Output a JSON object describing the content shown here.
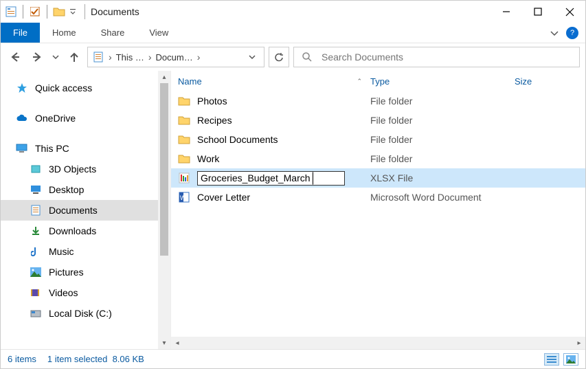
{
  "titlebar": {
    "title": "Documents"
  },
  "ribbon": {
    "file": "File",
    "tabs": [
      "Home",
      "Share",
      "View"
    ]
  },
  "nav": {
    "crumbs": [
      "This …",
      "Docum…"
    ],
    "search_placeholder": "Search Documents"
  },
  "sidebar": {
    "quick_access": "Quick access",
    "onedrive": "OneDrive",
    "this_pc": "This PC",
    "children": [
      "3D Objects",
      "Desktop",
      "Documents",
      "Downloads",
      "Music",
      "Pictures",
      "Videos",
      "Local Disk (C:)"
    ],
    "selected_index": 2
  },
  "columns": {
    "name": "Name",
    "type": "Type",
    "size": "Size"
  },
  "files": [
    {
      "name": "Photos",
      "type": "File folder",
      "kind": "folder"
    },
    {
      "name": "Recipes",
      "type": "File folder",
      "kind": "folder"
    },
    {
      "name": "School Documents",
      "type": "File folder",
      "kind": "folder"
    },
    {
      "name": "Work",
      "type": "File folder",
      "kind": "folder"
    },
    {
      "name": "Groceries_Budget_March",
      "type": "XLSX File",
      "kind": "xlsx",
      "renaming": true,
      "selected": true
    },
    {
      "name": "Cover Letter",
      "type": "Microsoft Word Document",
      "kind": "docx"
    }
  ],
  "status": {
    "item_count": "6 items",
    "selection": "1 item selected",
    "size": "8.06 KB"
  }
}
